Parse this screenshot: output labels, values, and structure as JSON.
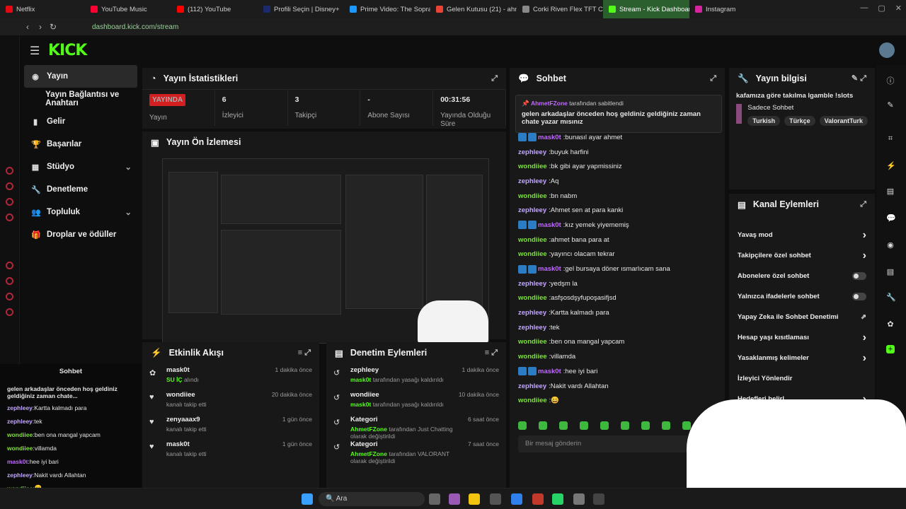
{
  "browser": {
    "tabs": [
      {
        "label": "Netflix",
        "color": "#e50914"
      },
      {
        "label": "YouTube Music",
        "color": "#ff0033"
      },
      {
        "label": "(112) YouTube",
        "color": "#ff0000"
      },
      {
        "label": "Profili Seçin | Disney+",
        "color": "#1a2a6c"
      },
      {
        "label": "Prime Video: The Sopra",
        "color": "#1a98ff"
      },
      {
        "label": "Gelen Kutusu (21) - ahme",
        "color": "#ea4335"
      },
      {
        "label": "Corki Riven Flex TFT Co",
        "color": "#888888"
      },
      {
        "label": "Stream - Kick Dashboard",
        "color": "#53fc18",
        "active": true
      },
      {
        "label": "Instagram",
        "color": "#d6249f"
      }
    ],
    "url": "dashboard.kick.com/stream"
  },
  "app": {
    "logo": "KICK",
    "nav": [
      {
        "label": "Yayın",
        "icon": "broadcast-icon",
        "active": true
      },
      {
        "label": "Yayın Bağlantısı ve Anahtarı",
        "icon": ""
      },
      {
        "label": "Gelir",
        "icon": "chart-icon"
      },
      {
        "label": "Başarılar",
        "icon": "trophy-icon"
      },
      {
        "label": "Stüdyo",
        "icon": "studio-icon",
        "chev": true
      },
      {
        "label": "Denetleme",
        "icon": "wrench-icon"
      },
      {
        "label": "Topluluk",
        "icon": "community-icon",
        "chev": true
      },
      {
        "label": "Droplar ve ödüller",
        "icon": "gift-icon"
      }
    ]
  },
  "stats": {
    "title": "Yayın İstatistikleri",
    "live": "YAYINDA",
    "live_label": "Yayın",
    "items": [
      {
        "value": "6",
        "label": "İzleyici"
      },
      {
        "value": "3",
        "label": "Takipçi"
      },
      {
        "value": "-",
        "label": "Abone Sayısı"
      },
      {
        "value": "00:31:56",
        "label": "Yayında Olduğu Süre"
      }
    ]
  },
  "preview": {
    "title": "Yayın Ön İzlemesi"
  },
  "activity": {
    "title": "Etkinlik Akışı",
    "items": [
      {
        "name": "mask0t",
        "sub_green": "SU İÇ",
        "sub": "alındı",
        "time": "1 dakika önce",
        "icon": "drops-icon"
      },
      {
        "name": "wondiiee",
        "sub": "kanalı takip etti",
        "time": "20 dakika önce",
        "icon": "heart-icon"
      },
      {
        "name": "zenyaaax9",
        "sub": "kanalı takip etti",
        "time": "1 gün önce",
        "icon": "heart-icon"
      },
      {
        "name": "mask0t",
        "sub": "kanalı takip etti",
        "time": "1 gün önce",
        "icon": "heart-icon"
      }
    ]
  },
  "moderation": {
    "title": "Denetim Eylemleri",
    "items": [
      {
        "name": "zephleey",
        "sub_green": "mask0t",
        "sub": "tarafından yasağı kaldırıldı",
        "time": "1 dakika önce"
      },
      {
        "name": "wondiiee",
        "sub_green": "mask0t",
        "sub": "tarafından yasağı kaldırıldı",
        "time": "10 dakika önce"
      },
      {
        "name": "Kategori",
        "sub_green": "AhmetFZone",
        "sub": "tarafından Just Chatting olarak değiştirildi",
        "time": "6 saat önce"
      },
      {
        "name": "Kategori",
        "sub_green": "AhmetFZone",
        "sub": "tarafından VALORANT olarak değiştirildi",
        "time": "7 saat önce"
      }
    ]
  },
  "chat": {
    "title": "Sohbet",
    "pinned_by": "AhmetFZone",
    "pinned_suffix": "tarafından sabitlendi",
    "pinned_text": "gelen arkadaşlar önceden hoş geldiniz geldiğiniz zaman chate yazar mısınız",
    "messages": [
      {
        "u": "mask0t",
        "t": "nasıl ayar ahmet",
        "c": "m",
        "b": true,
        "pre": "bu"
      },
      {
        "u": "zephleey",
        "t": "buyuk harfini",
        "c": "z"
      },
      {
        "u": "wondiiee",
        "t": "bk gibi ayar yapmissiniz",
        "c": "w"
      },
      {
        "u": "zephleey",
        "t": "Aq",
        "c": "z"
      },
      {
        "u": "wondiiee",
        "t": "bn nabm",
        "c": "w"
      },
      {
        "u": "zephleey",
        "t": "Ahmet sen at para kanki",
        "c": "z"
      },
      {
        "u": "mask0t",
        "t": "kız yemek yiyememiş",
        "c": "m",
        "b": true
      },
      {
        "u": "wondiiee",
        "t": "ahmet bana para at",
        "c": "w"
      },
      {
        "u": "wondiiee",
        "t": "yayıncı olacam tekrar",
        "c": "w"
      },
      {
        "u": "mask0t",
        "t": "gel bursaya döner ısmarlıcam sana",
        "c": "m",
        "b": true
      },
      {
        "u": "zephleey",
        "t": "yedşm la",
        "c": "z"
      },
      {
        "u": "wondiiee",
        "t": "asfşosdşyfupoşasifjsd",
        "c": "w"
      },
      {
        "u": "zephleey",
        "t": "Kartta kalmadı para",
        "c": "z"
      },
      {
        "u": "zephleey",
        "t": "tek",
        "c": "z"
      },
      {
        "u": "wondiiee",
        "t": "ben ona mangal yapcam",
        "c": "w"
      },
      {
        "u": "wondiiee",
        "t": "villamda",
        "c": "w"
      },
      {
        "u": "mask0t",
        "t": "hee iyi bari",
        "c": "m",
        "b": true
      },
      {
        "u": "zephleey",
        "t": "Nakit vardı Allahtan",
        "c": "z"
      },
      {
        "u": "wondiiee",
        "t": "😄",
        "c": "w"
      }
    ],
    "placeholder": "Bir mesaj gönderin"
  },
  "info": {
    "title": "Yayın bilgisi",
    "stream_title": "kafamıza göre takılma lgamble !slots",
    "category": "Sadece Sohbet",
    "tags": [
      "Turkish",
      "Türkçe",
      "ValorantTurk"
    ]
  },
  "actions": {
    "title": "Kanal Eylemleri",
    "items": [
      {
        "label": "Yavaş mod",
        "kind": "arrow"
      },
      {
        "label": "Takipçilere özel sohbet",
        "kind": "arrow"
      },
      {
        "label": "Abonelere özel sohbet",
        "kind": "toggle"
      },
      {
        "label": "Yalnızca ifadelerle sohbet",
        "kind": "toggle"
      },
      {
        "label": "Yapay Zeka ile Sohbet Denetimi",
        "kind": "external"
      },
      {
        "label": "Hesap yaşı kısıtlaması",
        "kind": "arrow"
      },
      {
        "label": "Yasaklanmış kelimeler",
        "kind": "arrow"
      },
      {
        "label": "İzleyici Yönlendir",
        "kind": "none"
      },
      {
        "label": "Hedefleri belirl",
        "kind": "arrow"
      }
    ]
  },
  "overlay": {
    "title": "Sohbet",
    "lines": [
      {
        "u": "zephleey",
        "t": "Kartta kalmadı para"
      },
      {
        "u": "zephleey",
        "t": "tek"
      },
      {
        "u": "wondiiee",
        "t": "ben ona mangal yapcam"
      },
      {
        "u": "wondiiee",
        "t": "villamda"
      },
      {
        "u": "mask0t",
        "t": "hee iyi bari"
      },
      {
        "u": "zephleey",
        "t": "Nakit vardı Allahtan"
      },
      {
        "u": "wondiiee",
        "t": "😄"
      }
    ],
    "pinned": "gelen arkadaşlar önceden hoş geldiniz geldiğiniz zaman chate..."
  },
  "taskbar": {
    "search": "Ara"
  }
}
